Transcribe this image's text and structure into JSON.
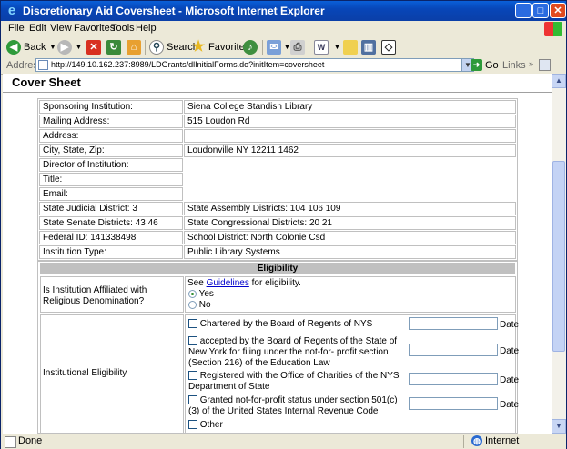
{
  "window": {
    "title": "Discretionary Aid Coversheet - Microsoft Internet Explorer",
    "minimize": "_",
    "maximize": "□",
    "close": "✕"
  },
  "menu": [
    "File",
    "Edit",
    "View",
    "Favorites",
    "Tools",
    "Help"
  ],
  "toolbar": {
    "back": "Back",
    "search": "Search",
    "favorites": "Favorites"
  },
  "address": {
    "label": "Address",
    "url": "http://149.10.162.237:8989/LDGrants/dlInitialForms.do?initItem=coversheet",
    "go": "Go",
    "links": "Links"
  },
  "page": {
    "title": "Cover Sheet",
    "cover_rows": [
      {
        "left": "Sponsoring Institution:",
        "right": "Siena College Standish Library"
      },
      {
        "left": "Mailing Address:",
        "right": "515 Loudon Rd"
      },
      {
        "left": "Address:",
        "right": ""
      },
      {
        "left": "City, State, Zip:",
        "right": "Loudonville NY 12211 1462"
      },
      {
        "left": "Director of Institution:",
        "right": ""
      },
      {
        "left": "Title:",
        "right": ""
      },
      {
        "left": "Email:",
        "right": ""
      },
      {
        "left": "State Judicial District: 3",
        "right": "State Assembly Districts: 104 106 109"
      },
      {
        "left": "State Senate Districts: 43 46",
        "right": "State Congressional Districts: 20 21"
      },
      {
        "left": "Federal ID: 141338498",
        "right": "School District: North Colonie Csd"
      },
      {
        "left": "Institution Type:",
        "right": "Public Library Systems"
      }
    ],
    "eligibility": {
      "header": "Eligibility",
      "religious_question": "Is Institution Affiliated with Religious Denomination?",
      "see_prefix": "See ",
      "guidelines_link": "Guidelines",
      "see_suffix": " for eligibility.",
      "yes": "Yes",
      "no": "No",
      "selected": "Yes",
      "institutional_label": "Institutional Eligibility",
      "date_label": "Date",
      "options": [
        "Chartered by the Board of Regents of NYS",
        "accepted by the Board of Regents of the State of New York for filing under the not-for- profit section (Section 216) of the Education Law",
        "Registered with the Office of Charities of the NYS Department of State",
        "Granted not-for-profit status under section 501(c)(3) of the United States Internal Revenue Code",
        "Other"
      ]
    }
  },
  "status": {
    "left": "Done",
    "zone": "Internet"
  }
}
